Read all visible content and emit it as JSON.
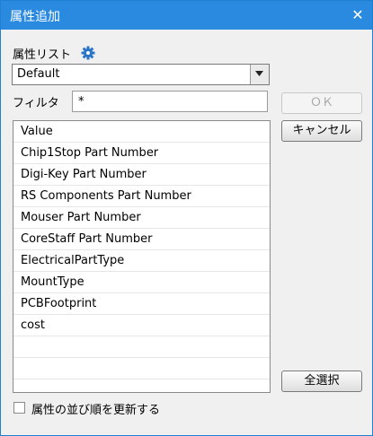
{
  "window": {
    "title": "属性追加",
    "close_label": "✕"
  },
  "attr_list": {
    "label": "属性リスト",
    "selected": "Default"
  },
  "filter": {
    "label": "フィルタ",
    "value": "*"
  },
  "buttons": {
    "ok": "ＯＫ",
    "cancel": "キャンセル",
    "select_all": "全選択"
  },
  "attributes": [
    "Value",
    "Chip1Stop Part Number",
    "Digi-Key Part Number",
    "RS Components Part Number",
    "Mouser Part Number",
    "CoreStaff Part Number",
    "ElectricalPartType",
    "MountType",
    "PCBFootprint",
    "cost",
    "",
    "",
    ""
  ],
  "update_order": {
    "label": "属性の並び順を更新する",
    "checked": false
  },
  "colors": {
    "titlebar": "#2a8ae0",
    "gear": "#2a74c8",
    "window_bg": "#f0f0f0"
  },
  "icons": {
    "settings": "gear-icon",
    "close": "close-icon",
    "dropdown": "chevron-down-icon"
  }
}
